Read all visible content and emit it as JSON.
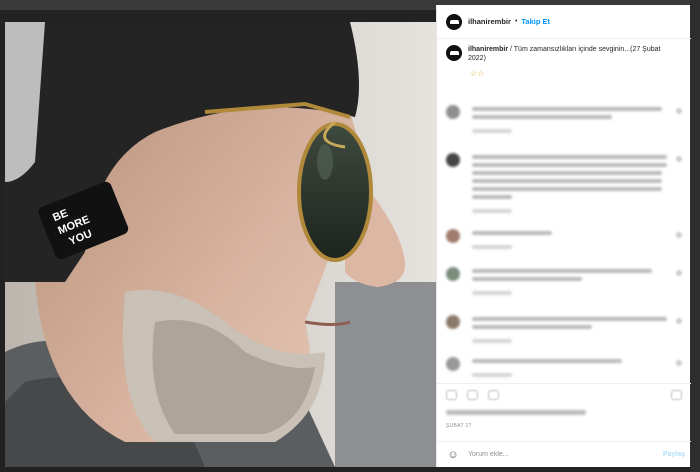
{
  "post": {
    "photo_alt": "man-profile-photo",
    "photo_text": [
      "BE",
      "MORE",
      "YOU"
    ]
  },
  "header": {
    "username": "ilhanirembir",
    "separator": "•",
    "follow_label": "Takip Et"
  },
  "caption": {
    "username": "ilhanirembir",
    "text": " / Tüm zamansızlıkları içinde sevginin...(27 Şubat 2022)",
    "emoji": "☆☆"
  },
  "footer": {
    "date": "ŞUBAT 27",
    "comment_placeholder": "Yorum ekle...",
    "post_label": "Paylaş",
    "emoji_icon": "☺"
  },
  "colors": {
    "accent": "#0095f6",
    "post_disabled": "#b2dffc"
  }
}
